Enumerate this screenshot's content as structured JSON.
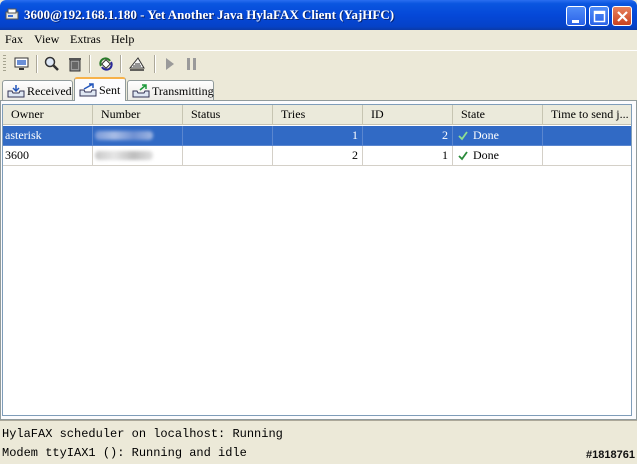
{
  "window": {
    "title": "3600@192.168.1.180 - Yet Another Java HylaFAX Client (YajHFC)",
    "accent": "#0548d8"
  },
  "menu": [
    "Fax",
    "View",
    "Extras",
    "Help"
  ],
  "toolbar": {
    "icons": [
      "view-fax-icon",
      "search-icon",
      "trash-icon",
      "refresh-icon",
      "resend-icon",
      "play-icon",
      "pause-icon"
    ]
  },
  "tabs": [
    {
      "label": "Received",
      "active": false
    },
    {
      "label": "Sent",
      "active": true
    },
    {
      "label": "Transmitting",
      "active": false
    }
  ],
  "table": {
    "columns": [
      "Owner",
      "Number",
      "Status",
      "Tries",
      "ID",
      "State",
      "Time to send j..."
    ],
    "rows": [
      {
        "owner": "asterisk",
        "number": "",
        "status": "",
        "tries": "1",
        "id": "2",
        "state": "Done",
        "time": "",
        "selected": true
      },
      {
        "owner": "3600",
        "number": "",
        "status": "",
        "tries": "2",
        "id": "1",
        "state": "Done",
        "time": "",
        "selected": false
      }
    ]
  },
  "status": {
    "line1": "HylaFAX scheduler on localhost: Running",
    "line2": "Modem ttyIAX1 (): Running and idle",
    "watermark": "#1818761"
  }
}
